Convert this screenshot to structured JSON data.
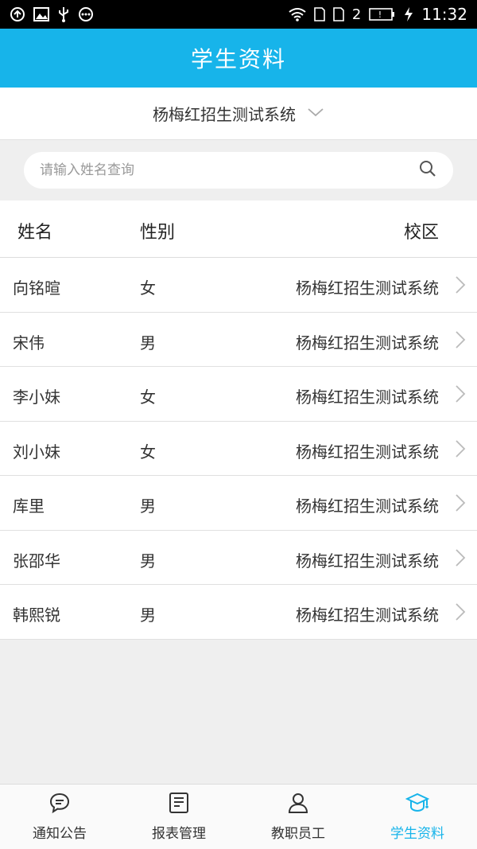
{
  "status_bar": {
    "left_icons": [
      "sync-icon",
      "image-icon",
      "usb-icon",
      "more-icon"
    ],
    "right_icons": [
      "wifi-icon",
      "sim1-icon",
      "sim2-icon",
      "battery-icon",
      "charging-icon"
    ],
    "sim_number": "2",
    "time": "11:32"
  },
  "header": {
    "title": "学生资料"
  },
  "campus_selector": {
    "label": "杨梅红招生测试系统"
  },
  "search": {
    "placeholder": "请输入姓名查询",
    "value": ""
  },
  "table": {
    "columns": {
      "name": "姓名",
      "gender": "性别",
      "campus": "校区"
    },
    "rows": [
      {
        "name": "向铭暄",
        "gender": "女",
        "campus": "杨梅红招生测试系统"
      },
      {
        "name": "宋伟",
        "gender": "男",
        "campus": "杨梅红招生测试系统"
      },
      {
        "name": "李小妹",
        "gender": "女",
        "campus": "杨梅红招生测试系统"
      },
      {
        "name": "刘小妹",
        "gender": "女",
        "campus": "杨梅红招生测试系统"
      },
      {
        "name": "库里",
        "gender": "男",
        "campus": "杨梅红招生测试系统"
      },
      {
        "name": "张邵华",
        "gender": "男",
        "campus": "杨梅红招生测试系统"
      },
      {
        "name": "韩熙锐",
        "gender": "男",
        "campus": "杨梅红招生测试系统"
      }
    ]
  },
  "bottom_nav": {
    "items": [
      {
        "label": "通知公告",
        "icon": "chat-bubble-icon",
        "active": false
      },
      {
        "label": "报表管理",
        "icon": "report-icon",
        "active": false
      },
      {
        "label": "教职员工",
        "icon": "person-icon",
        "active": false
      },
      {
        "label": "学生资料",
        "icon": "graduation-cap-icon",
        "active": true
      }
    ]
  },
  "colors": {
    "accent": "#17b4ea",
    "background": "#efefef",
    "text": "#333333",
    "status_bar": "#000000"
  }
}
